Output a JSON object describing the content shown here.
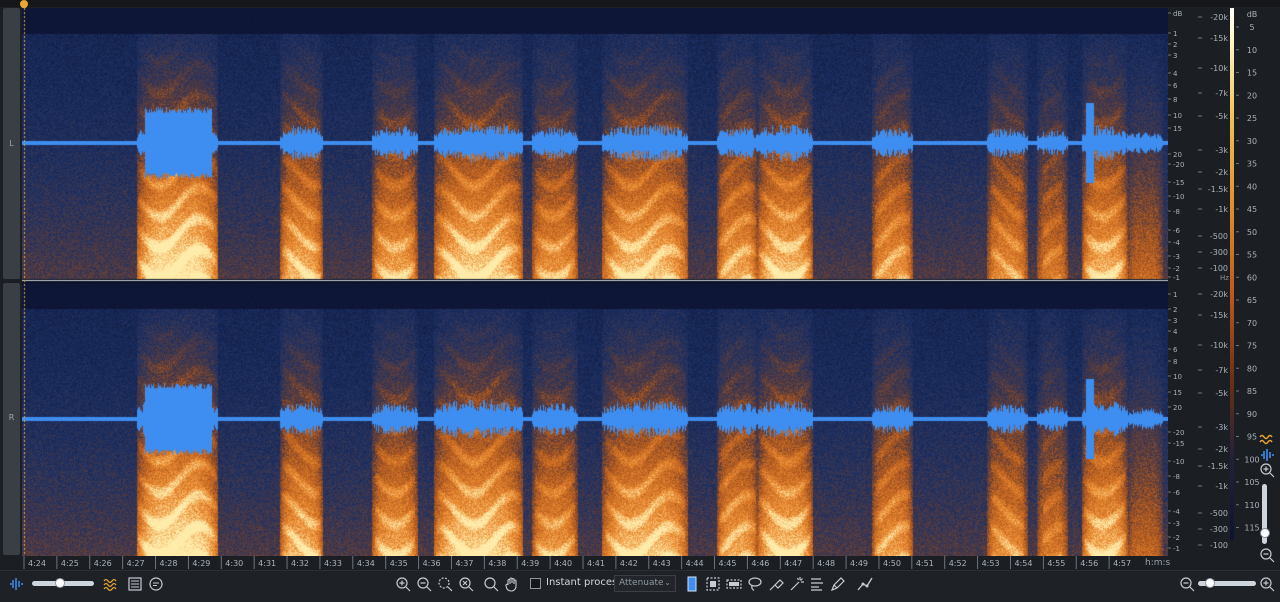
{
  "channels": [
    {
      "id": "L",
      "label": "L"
    },
    {
      "id": "R",
      "label": "R"
    }
  ],
  "hz_scale": {
    "labels_right": [
      "-20k",
      "-15k",
      "-10k",
      "-7k",
      "-5k",
      "-3k",
      "-2k",
      "-1.5k",
      "-1k",
      "-500",
      "-300",
      "-100"
    ],
    "labels_right_values_hz": [
      20000,
      15000,
      10000,
      7000,
      5000,
      3000,
      2000,
      1500,
      1000,
      500,
      300,
      100
    ],
    "db_labels_L": [
      "dB",
      "1",
      "2",
      "3",
      "4",
      "6",
      "8",
      "10",
      "15",
      "20",
      "-20",
      "-15",
      "-10",
      "-8",
      "-6",
      "-4",
      "-3",
      "-2",
      "-1"
    ],
    "db_labels_R": [
      "1",
      "2",
      "3",
      "4",
      "6",
      "8",
      "10",
      "15",
      "20",
      "-20",
      "-15",
      "-10",
      "-8",
      "-6",
      "-4",
      "-3",
      "-2",
      "-1"
    ],
    "unit": "Hz"
  },
  "db_scale": {
    "unit": "dB",
    "labels": [
      "5",
      "10",
      "15",
      "20",
      "25",
      "30",
      "35",
      "40",
      "45",
      "50",
      "55",
      "60",
      "65",
      "70",
      "75",
      "80",
      "85",
      "90",
      "95",
      "100",
      "105",
      "110",
      "115"
    ]
  },
  "timeline": {
    "ticks": [
      "4:24",
      "4:25",
      "4:26",
      "4:27",
      "4:28",
      "4:29",
      "4:30",
      "4:31",
      "4:32",
      "4:33",
      "4:34",
      "4:35",
      "4:36",
      "4:37",
      "4:38",
      "4:39",
      "4:40",
      "4:41",
      "4:42",
      "4:43",
      "4:44",
      "4:45",
      "4:46",
      "4:47",
      "4:48",
      "4:49",
      "4:50",
      "4:51",
      "4:52",
      "4:53",
      "4:54",
      "4:55",
      "4:56",
      "4:57"
    ],
    "format_label": "h:m:s"
  },
  "toolbar": {
    "instant_process_label": "Instant process",
    "instant_process_checked": false,
    "mode_value": "Attenuate",
    "waveform_spectrogram_blend": 0.45,
    "horizontal_zoom": 0.2,
    "vertical_zoom": 0.2
  },
  "icons": {
    "waveform": "waveform-icon",
    "spectrogram": "spectrogram-icon",
    "list": "list-icon",
    "comment": "comment-icon",
    "zoom_in": "zoom-in-icon",
    "zoom_out": "zoom-out-icon",
    "zoom_selection": "zoom-selection-icon",
    "zoom_fit": "zoom-fit-icon",
    "magnify": "magnify-icon",
    "hand": "hand-icon",
    "time_select": "time-selection-icon",
    "time_freq_select": "time-frequency-selection-icon",
    "frequency_select": "frequency-selection-icon",
    "lasso": "lasso-icon",
    "brush": "brush-icon",
    "magic_wand": "magic-wand-icon",
    "harmonic": "harmonic-select-icon",
    "pencil": "pencil-icon",
    "curve": "curve-icon"
  },
  "colors": {
    "waveform": "#3d8ef0",
    "spectrogram_hot": "#f0a040",
    "spectrogram_cold": "#1a2a60",
    "accent": "#e8a634"
  }
}
